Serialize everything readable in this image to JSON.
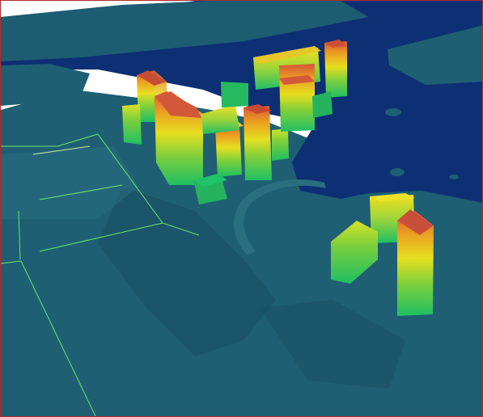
{
  "view": {
    "kind": "3d-city-height-map",
    "colors": {
      "sky": "#ffffff",
      "water": "#0d2f74",
      "ground": "#1f5f73",
      "ground_shadow": "#1a5367",
      "ground_light": "#2a6e80",
      "road_outline": "#6fe36a",
      "road_outline_light": "#c8f0a0",
      "frame": "#b22a2a"
    },
    "height_gradient": [
      "#20c060",
      "#8ad23a",
      "#f0e020",
      "#f0a020",
      "#e06838",
      "#c04830"
    ]
  }
}
